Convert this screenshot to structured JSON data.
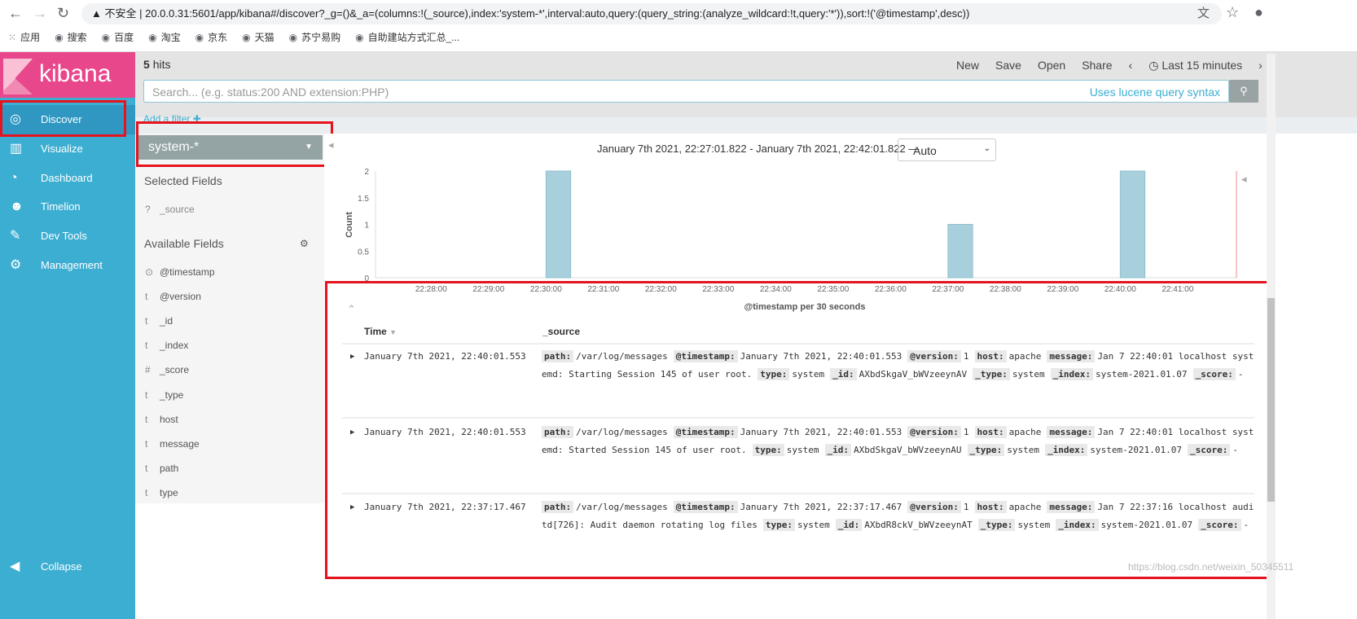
{
  "browser": {
    "security": "不安全",
    "url": "20.0.0.31:5601/app/kibana#/discover?_g=()&_a=(columns:!(_source),index:'system-*',interval:auto,query:(query_string:(analyze_wildcard:!t,query:'*')),sort:!('@timestamp',desc))",
    "bookmarks": [
      "应用",
      "搜索",
      "百度",
      "淘宝",
      "京东",
      "天猫",
      "苏宁易购",
      "自助建站方式汇总_..."
    ]
  },
  "app": {
    "logo": "kibana",
    "nav": [
      {
        "label": "Discover",
        "icon": "compass-icon"
      },
      {
        "label": "Visualize",
        "icon": "bar-chart-icon"
      },
      {
        "label": "Dashboard",
        "icon": "dashboard-icon"
      },
      {
        "label": "Timelion",
        "icon": "timelion-icon"
      },
      {
        "label": "Dev Tools",
        "icon": "wrench-icon"
      },
      {
        "label": "Management",
        "icon": "gear-icon"
      }
    ],
    "collapse": "Collapse"
  },
  "topbar": {
    "hits_count": "5",
    "hits_label": "hits",
    "new": "New",
    "save": "Save",
    "open": "Open",
    "share": "Share",
    "time": "Last 15 minutes",
    "search_placeholder": "Search... (e.g. status:200 AND extension:PHP)",
    "lucene": "Uses lucene query syntax",
    "add_filter": "Add a filter"
  },
  "fields": {
    "index_pattern": "system-*",
    "selected_title": "Selected Fields",
    "selected": [
      {
        "type": "?",
        "name": "_source"
      }
    ],
    "available_title": "Available Fields",
    "available": [
      {
        "type": "⊙",
        "name": "@timestamp"
      },
      {
        "type": "t",
        "name": "@version"
      },
      {
        "type": "t",
        "name": "_id"
      },
      {
        "type": "t",
        "name": "_index"
      },
      {
        "type": "#",
        "name": "_score"
      },
      {
        "type": "t",
        "name": "_type"
      },
      {
        "type": "t",
        "name": "host"
      },
      {
        "type": "t",
        "name": "message"
      },
      {
        "type": "t",
        "name": "path"
      },
      {
        "type": "t",
        "name": "type"
      }
    ]
  },
  "chart_data": {
    "type": "bar",
    "range_label": "January 7th 2021, 22:27:01.822 - January 7th 2021, 22:42:01.822 —",
    "interval": "Auto",
    "xlabel": "@timestamp per 30 seconds",
    "ylabel": "Count",
    "ylim": [
      0,
      2
    ],
    "yticks": [
      "0",
      "0.5",
      "1",
      "1.5",
      "2"
    ],
    "xticks": [
      "22:28:00",
      "22:29:00",
      "22:30:00",
      "22:31:00",
      "22:32:00",
      "22:33:00",
      "22:34:00",
      "22:35:00",
      "22:36:00",
      "22:37:00",
      "22:38:00",
      "22:39:00",
      "22:40:00",
      "22:41:00"
    ],
    "x": [
      "22:30:00",
      "22:37:00",
      "22:40:00"
    ],
    "values": [
      2,
      1,
      2
    ],
    "bar_color": "#a8d0dc"
  },
  "table": {
    "headers": [
      "Time",
      "_source"
    ],
    "rows": [
      {
        "time": "January 7th 2021, 22:40:01.553",
        "fields": [
          [
            "path:",
            "/var/log/messages"
          ],
          [
            "@timestamp:",
            "January 7th 2021, 22:40:01.553"
          ],
          [
            "@version:",
            "1"
          ],
          [
            "host:",
            "apache"
          ],
          [
            "message:",
            "Jan 7 22:40:01 localhost systemd: Starting Session 145 of user root."
          ],
          [
            "type:",
            "system"
          ],
          [
            "_id:",
            "AXbdSkgaV_bWVzeeynAV"
          ],
          [
            "_type:",
            "system"
          ],
          [
            "_index:",
            "system-2021.01.07"
          ],
          [
            "_score:",
            "-"
          ]
        ]
      },
      {
        "time": "January 7th 2021, 22:40:01.553",
        "fields": [
          [
            "path:",
            "/var/log/messages"
          ],
          [
            "@timestamp:",
            "January 7th 2021, 22:40:01.553"
          ],
          [
            "@version:",
            "1"
          ],
          [
            "host:",
            "apache"
          ],
          [
            "message:",
            "Jan 7 22:40:01 localhost systemd: Started Session 145 of user root."
          ],
          [
            "type:",
            "system"
          ],
          [
            "_id:",
            "AXbdSkgaV_bWVzeeynAU"
          ],
          [
            "_type:",
            "system"
          ],
          [
            "_index:",
            "system-2021.01.07"
          ],
          [
            "_score:",
            "-"
          ]
        ]
      },
      {
        "time": "January 7th 2021, 22:37:17.467",
        "fields": [
          [
            "path:",
            "/var/log/messages"
          ],
          [
            "@timestamp:",
            "January 7th 2021, 22:37:17.467"
          ],
          [
            "@version:",
            "1"
          ],
          [
            "host:",
            "apache"
          ],
          [
            "message:",
            "Jan 7 22:37:16 localhost auditd[726]: Audit daemon rotating log files"
          ],
          [
            "type:",
            "system"
          ],
          [
            "_id:",
            "AXbdR8ckV_bWVzeeynAT"
          ],
          [
            "_type:",
            "system"
          ],
          [
            "_index:",
            "system-2021.01.07"
          ],
          [
            "_score:",
            "-"
          ]
        ]
      }
    ]
  },
  "watermark": "https://blog.csdn.net/weixin_50345511"
}
